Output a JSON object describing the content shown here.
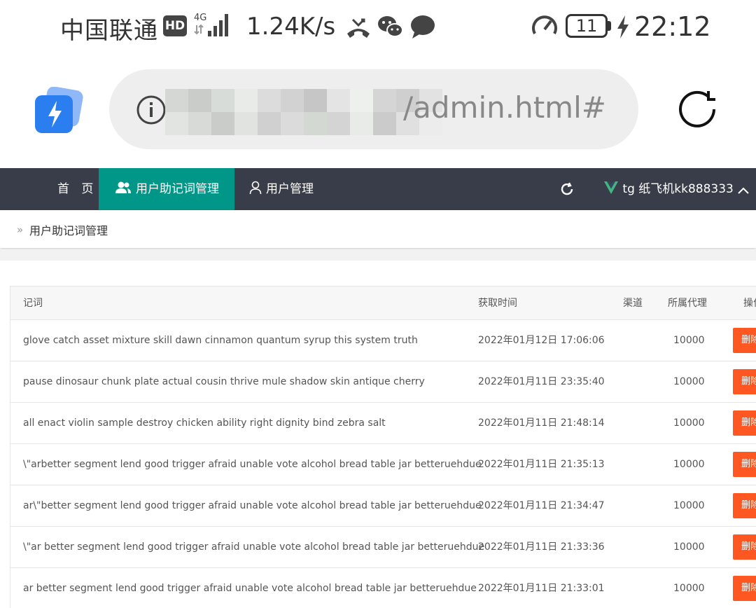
{
  "status_bar": {
    "carrier": "中国联通",
    "hd_badge": "HD",
    "network_type": "4G",
    "net_speed": "1.24K/s",
    "battery": "11",
    "time": "22:12",
    "icons": [
      "missed-call-icon",
      "wechat-icon",
      "message-icon",
      "speed-gauge-icon",
      "charging-icon"
    ]
  },
  "browser": {
    "url_visible": "/admin.html#",
    "icons": [
      "app-bolt-icon",
      "info-icon",
      "reload-icon"
    ]
  },
  "nav": {
    "home": "首 页",
    "mnemonic": "用户助记词管理",
    "users": "用户管理",
    "user_name": "tg 纸飞机kk888333",
    "active_color": "#009688",
    "bar_color": "#393d49"
  },
  "breadcrumb": {
    "chevron": "»",
    "current": "用户助记词管理"
  },
  "table": {
    "headers": {
      "words": "记词",
      "time": "获取时间",
      "channel": "渠道",
      "agent": "所属代理",
      "op": "操作"
    },
    "delete_label": "删除",
    "delete_color": "#ff5722",
    "rows": [
      {
        "words": "glove catch asset mixture skill dawn cinnamon quantum syrup this system truth",
        "time": "2022年01月12日 17:06:06",
        "channel": "",
        "agent": "10000"
      },
      {
        "words": "pause dinosaur chunk plate actual cousin thrive mule shadow skin antique cherry",
        "time": "2022年01月11日 23:35:40",
        "channel": "",
        "agent": "10000"
      },
      {
        "words": "all enact violin sample destroy chicken ability right dignity bind zebra salt",
        "time": "2022年01月11日 21:48:14",
        "channel": "",
        "agent": "10000"
      },
      {
        "words": "\\\"arbetter segment lend good trigger afraid unable vote alcohol bread table jar betteruehdue",
        "time": "2022年01月11日 21:35:13",
        "channel": "",
        "agent": "10000"
      },
      {
        "words": "ar\\\"better segment lend good trigger afraid unable vote alcohol bread table jar betteruehdue",
        "time": "2022年01月11日 21:34:47",
        "channel": "",
        "agent": "10000"
      },
      {
        "words": "\\\"ar better segment lend good trigger afraid unable vote alcohol bread table jar betteruehdue",
        "time": "2022年01月11日 21:33:36",
        "channel": "",
        "agent": "10000"
      },
      {
        "words": "ar better segment lend good trigger afraid unable vote alcohol bread table jar betteruehdue",
        "time": "2022年01月11日 21:33:01",
        "channel": "",
        "agent": "10000"
      }
    ]
  }
}
